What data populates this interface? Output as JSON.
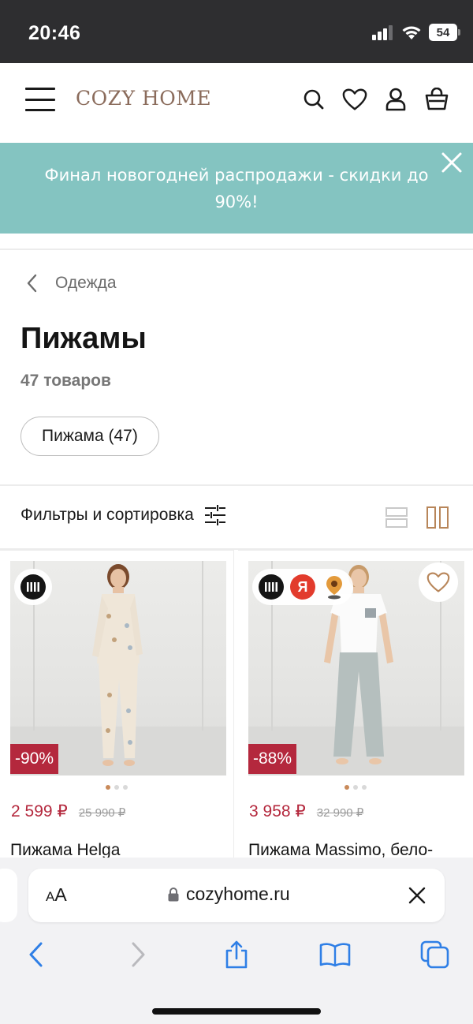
{
  "status_bar": {
    "time": "20:46",
    "battery": "54",
    "icons": [
      "signal-icon",
      "wifi-icon",
      "battery-icon"
    ]
  },
  "header": {
    "logo": "COZY HOME",
    "icons": [
      "menu-icon",
      "search-icon",
      "heart-icon",
      "user-icon",
      "bag-icon"
    ]
  },
  "banner": {
    "text": "Финал новогодней распродажи - скидки до 90%!",
    "background": "#84c4c1"
  },
  "breadcrumb": {
    "label": "Одежда"
  },
  "page": {
    "title": "Пижамы",
    "count": "47 товаров"
  },
  "chip": {
    "label": "Пижама (47)"
  },
  "filter": {
    "label": "Фильтры и сортировка"
  },
  "products": [
    {
      "name": "Пижама Helga",
      "price": "2 599 ₽",
      "old_price": "25 990 ₽",
      "discount": "-90%",
      "badges": [
        "partner-stripes-icon"
      ],
      "image_slide": 1,
      "image_slides_total": 3
    },
    {
      "name": "Пижама Massimo, бело-",
      "price": "3 958 ₽",
      "old_price": "32 990 ₽",
      "discount": "-88%",
      "badges": [
        "partner-stripes-icon",
        "yandex-icon",
        "location-pin-icon"
      ],
      "yandex_letter": "Я",
      "image_slide": 1,
      "image_slides_total": 3
    }
  ],
  "browser": {
    "aa_small": "A",
    "aa_big": "A",
    "url": "cozyhome.ru"
  },
  "colors": {
    "accent_price": "#b4283d",
    "brand_logo": "#8b6c5c",
    "toolbar_blue": "#2f7fe6"
  }
}
